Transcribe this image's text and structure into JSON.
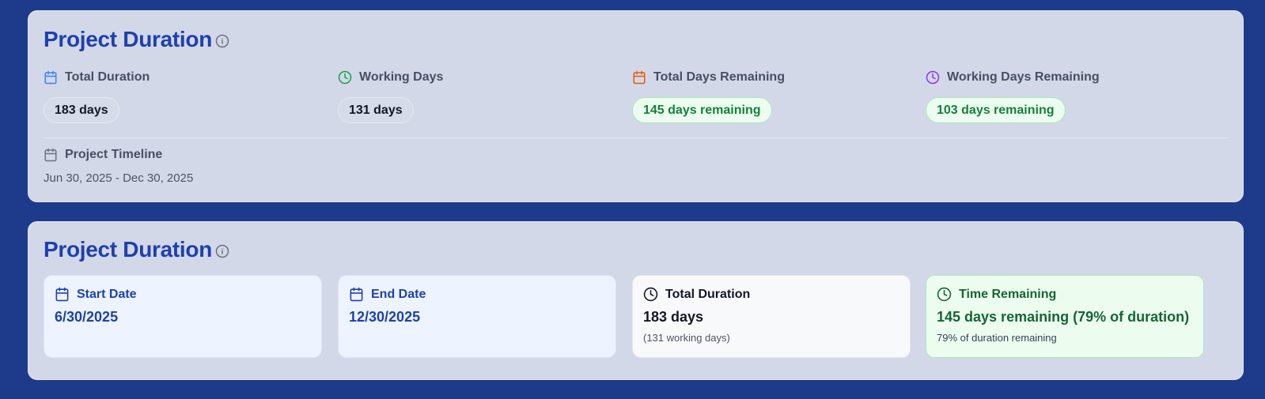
{
  "colors": {
    "background": "#1e3a8a",
    "title": "#1e40af",
    "green": "#15803d",
    "blue_icon": "#3b82f6",
    "green_icon": "#16a34a",
    "orange_icon": "#ea580c",
    "purple_icon": "#9333ea"
  },
  "summary_card": {
    "title": "Project Duration",
    "info_icon": "info-icon",
    "metrics": [
      {
        "label": "Total Duration",
        "value": "183 days",
        "icon": "calendar-icon"
      },
      {
        "label": "Working Days",
        "value": "131 days",
        "icon": "clock-icon"
      },
      {
        "label": "Total Days Remaining",
        "value": "145 days remaining",
        "icon": "calendar-icon"
      },
      {
        "label": "Working Days Remaining",
        "value": "103 days remaining",
        "icon": "clock-icon"
      }
    ],
    "timeline": {
      "label": "Project Timeline",
      "value": "Jun 30, 2025 - Dec 30, 2025",
      "icon": "calendar-icon"
    }
  },
  "detail_card": {
    "title": "Project Duration",
    "info_icon": "info-icon",
    "boxes": [
      {
        "label": "Start Date",
        "value": "6/30/2025",
        "icon": "calendar-icon"
      },
      {
        "label": "End Date",
        "value": "12/30/2025",
        "icon": "calendar-icon"
      },
      {
        "label": "Total Duration",
        "value": "183 days",
        "sub": "(131 working days)",
        "icon": "clock-icon"
      },
      {
        "label": "Time Remaining",
        "value": "145 days remaining (79% of duration)",
        "sub": "79% of duration remaining",
        "icon": "clock-icon"
      }
    ]
  }
}
